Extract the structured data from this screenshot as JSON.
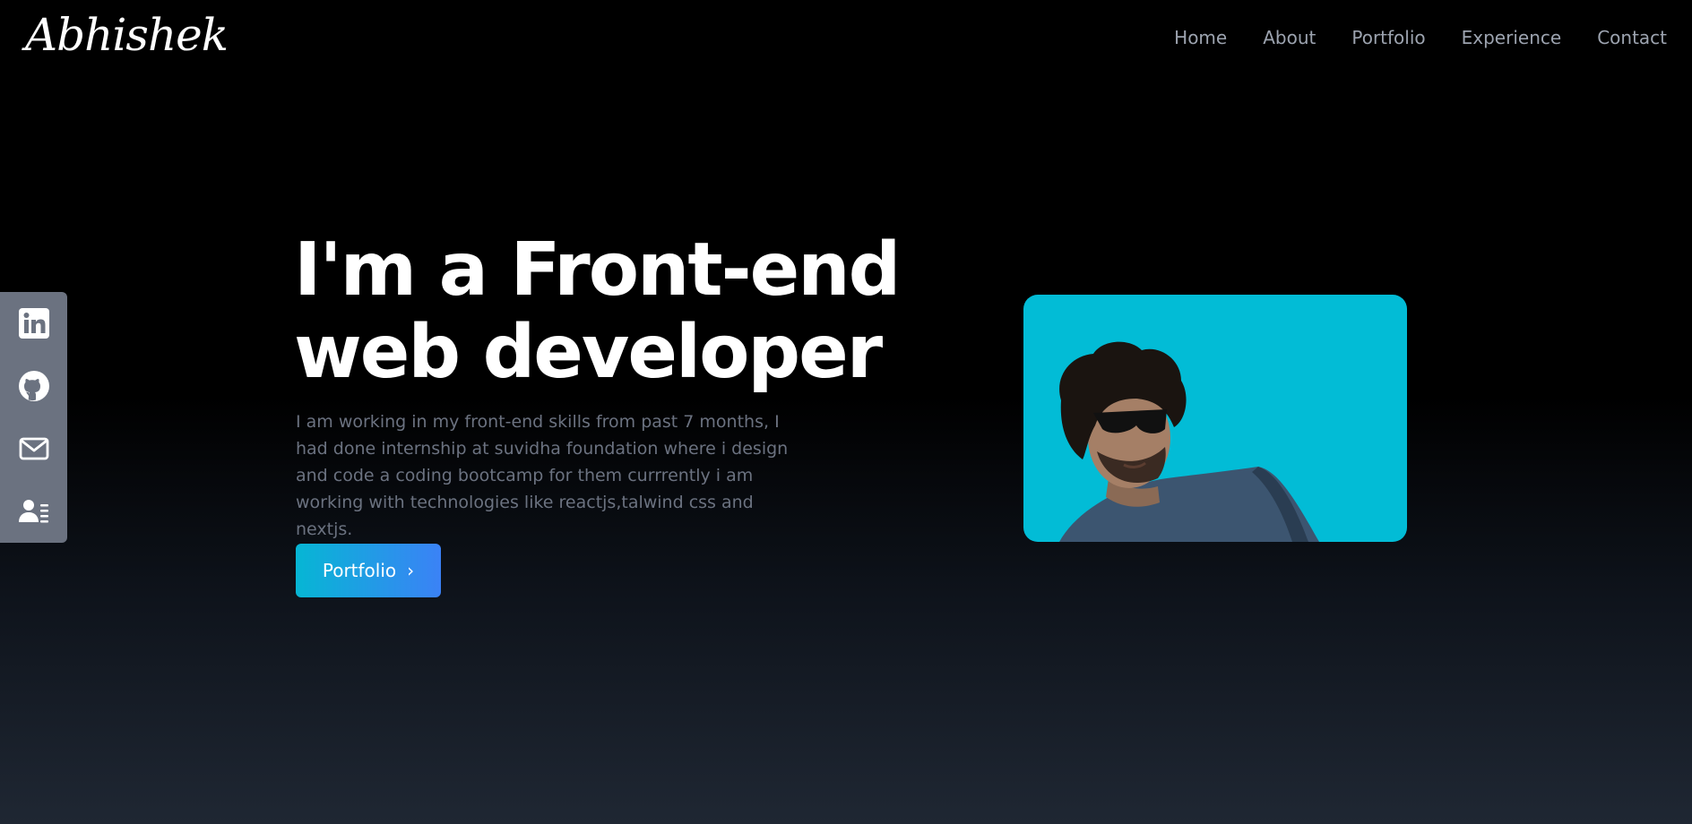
{
  "brand": {
    "logo_text": "Abhishek"
  },
  "nav": {
    "links": [
      {
        "label": "Home"
      },
      {
        "label": "About"
      },
      {
        "label": "Portfolio"
      },
      {
        "label": "Experience"
      },
      {
        "label": "Contact"
      }
    ]
  },
  "social": {
    "items": [
      {
        "icon": "linkedin-icon"
      },
      {
        "icon": "github-icon"
      },
      {
        "icon": "mail-icon"
      },
      {
        "icon": "resume-icon"
      }
    ]
  },
  "hero": {
    "title_line1": "I'm a Front-end",
    "title_line2": "web developer",
    "description": "I am working in my front-end skills from past 7 months, I had done internship at suvidha foundation where i design and code a coding bootcamp for them currrently i am working with technologies like reactjs,talwind css and nextjs.",
    "button_label": "Portfolio",
    "button_icon": "chevron-right-icon"
  },
  "colors": {
    "accent_start": "#06b6d4",
    "accent_end": "#3b82f6",
    "photo_bg": "#02bcd6",
    "social_bar_bg": "#6b7280"
  }
}
